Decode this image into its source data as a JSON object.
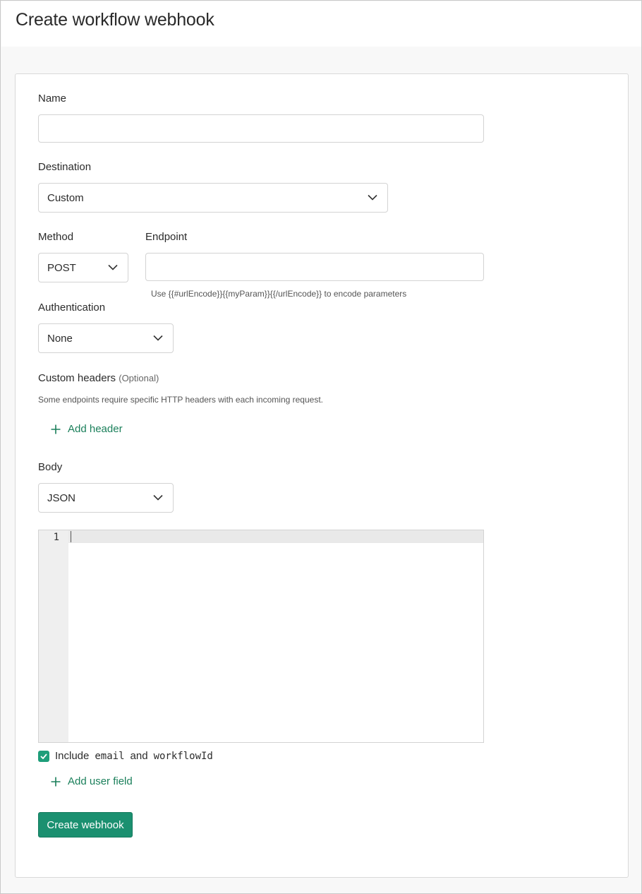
{
  "page": {
    "title": "Create workflow webhook"
  },
  "form": {
    "name": {
      "label": "Name",
      "value": ""
    },
    "destination": {
      "label": "Destination",
      "value": "Custom"
    },
    "method": {
      "label": "Method",
      "value": "POST"
    },
    "endpoint": {
      "label": "Endpoint",
      "value": "",
      "hint": "Use {{#urlEncode}}{{myParam}}{{/urlEncode}} to encode parameters"
    },
    "authentication": {
      "label": "Authentication",
      "value": "None"
    },
    "custom_headers": {
      "label": "Custom headers",
      "optional": "(Optional)",
      "description": "Some endpoints require specific HTTP headers with each incoming request.",
      "add_label": "Add header"
    },
    "body": {
      "label": "Body",
      "value": "JSON"
    },
    "editor": {
      "line_number": "1",
      "content": ""
    },
    "include": {
      "checked": true,
      "prefix": "Include",
      "field1": "email",
      "joiner": "and",
      "field2": "workflowId"
    },
    "add_user_field_label": "Add user field",
    "submit_label": "Create webhook"
  },
  "colors": {
    "accent": "#1b9070",
    "link": "#1a7f5a",
    "border": "#d3d3d3"
  },
  "icons": {
    "dropdown": "chevron-down-icon",
    "add": "plus-icon",
    "check": "check-icon"
  }
}
